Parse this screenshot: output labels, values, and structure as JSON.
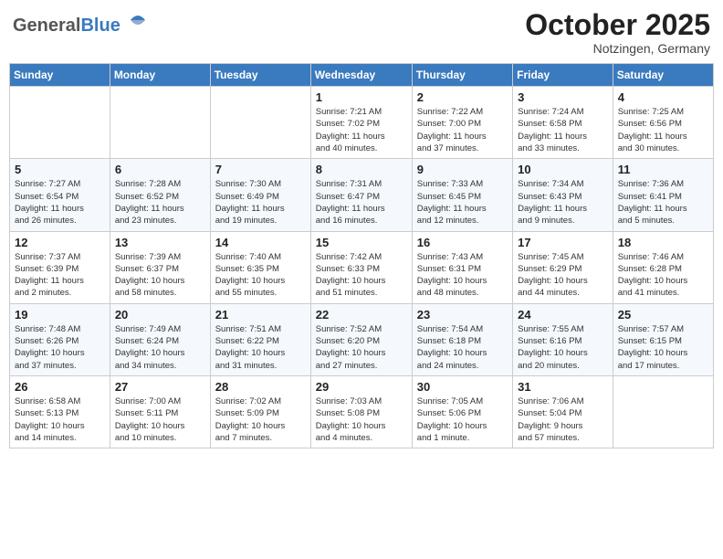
{
  "header": {
    "logo_general": "General",
    "logo_blue": "Blue",
    "month": "October 2025",
    "location": "Notzingen, Germany"
  },
  "weekdays": [
    "Sunday",
    "Monday",
    "Tuesday",
    "Wednesday",
    "Thursday",
    "Friday",
    "Saturday"
  ],
  "weeks": [
    [
      {
        "day": "",
        "info": ""
      },
      {
        "day": "",
        "info": ""
      },
      {
        "day": "",
        "info": ""
      },
      {
        "day": "1",
        "info": "Sunrise: 7:21 AM\nSunset: 7:02 PM\nDaylight: 11 hours\nand 40 minutes."
      },
      {
        "day": "2",
        "info": "Sunrise: 7:22 AM\nSunset: 7:00 PM\nDaylight: 11 hours\nand 37 minutes."
      },
      {
        "day": "3",
        "info": "Sunrise: 7:24 AM\nSunset: 6:58 PM\nDaylight: 11 hours\nand 33 minutes."
      },
      {
        "day": "4",
        "info": "Sunrise: 7:25 AM\nSunset: 6:56 PM\nDaylight: 11 hours\nand 30 minutes."
      }
    ],
    [
      {
        "day": "5",
        "info": "Sunrise: 7:27 AM\nSunset: 6:54 PM\nDaylight: 11 hours\nand 26 minutes."
      },
      {
        "day": "6",
        "info": "Sunrise: 7:28 AM\nSunset: 6:52 PM\nDaylight: 11 hours\nand 23 minutes."
      },
      {
        "day": "7",
        "info": "Sunrise: 7:30 AM\nSunset: 6:49 PM\nDaylight: 11 hours\nand 19 minutes."
      },
      {
        "day": "8",
        "info": "Sunrise: 7:31 AM\nSunset: 6:47 PM\nDaylight: 11 hours\nand 16 minutes."
      },
      {
        "day": "9",
        "info": "Sunrise: 7:33 AM\nSunset: 6:45 PM\nDaylight: 11 hours\nand 12 minutes."
      },
      {
        "day": "10",
        "info": "Sunrise: 7:34 AM\nSunset: 6:43 PM\nDaylight: 11 hours\nand 9 minutes."
      },
      {
        "day": "11",
        "info": "Sunrise: 7:36 AM\nSunset: 6:41 PM\nDaylight: 11 hours\nand 5 minutes."
      }
    ],
    [
      {
        "day": "12",
        "info": "Sunrise: 7:37 AM\nSunset: 6:39 PM\nDaylight: 11 hours\nand 2 minutes."
      },
      {
        "day": "13",
        "info": "Sunrise: 7:39 AM\nSunset: 6:37 PM\nDaylight: 10 hours\nand 58 minutes."
      },
      {
        "day": "14",
        "info": "Sunrise: 7:40 AM\nSunset: 6:35 PM\nDaylight: 10 hours\nand 55 minutes."
      },
      {
        "day": "15",
        "info": "Sunrise: 7:42 AM\nSunset: 6:33 PM\nDaylight: 10 hours\nand 51 minutes."
      },
      {
        "day": "16",
        "info": "Sunrise: 7:43 AM\nSunset: 6:31 PM\nDaylight: 10 hours\nand 48 minutes."
      },
      {
        "day": "17",
        "info": "Sunrise: 7:45 AM\nSunset: 6:29 PM\nDaylight: 10 hours\nand 44 minutes."
      },
      {
        "day": "18",
        "info": "Sunrise: 7:46 AM\nSunset: 6:28 PM\nDaylight: 10 hours\nand 41 minutes."
      }
    ],
    [
      {
        "day": "19",
        "info": "Sunrise: 7:48 AM\nSunset: 6:26 PM\nDaylight: 10 hours\nand 37 minutes."
      },
      {
        "day": "20",
        "info": "Sunrise: 7:49 AM\nSunset: 6:24 PM\nDaylight: 10 hours\nand 34 minutes."
      },
      {
        "day": "21",
        "info": "Sunrise: 7:51 AM\nSunset: 6:22 PM\nDaylight: 10 hours\nand 31 minutes."
      },
      {
        "day": "22",
        "info": "Sunrise: 7:52 AM\nSunset: 6:20 PM\nDaylight: 10 hours\nand 27 minutes."
      },
      {
        "day": "23",
        "info": "Sunrise: 7:54 AM\nSunset: 6:18 PM\nDaylight: 10 hours\nand 24 minutes."
      },
      {
        "day": "24",
        "info": "Sunrise: 7:55 AM\nSunset: 6:16 PM\nDaylight: 10 hours\nand 20 minutes."
      },
      {
        "day": "25",
        "info": "Sunrise: 7:57 AM\nSunset: 6:15 PM\nDaylight: 10 hours\nand 17 minutes."
      }
    ],
    [
      {
        "day": "26",
        "info": "Sunrise: 6:58 AM\nSunset: 5:13 PM\nDaylight: 10 hours\nand 14 minutes."
      },
      {
        "day": "27",
        "info": "Sunrise: 7:00 AM\nSunset: 5:11 PM\nDaylight: 10 hours\nand 10 minutes."
      },
      {
        "day": "28",
        "info": "Sunrise: 7:02 AM\nSunset: 5:09 PM\nDaylight: 10 hours\nand 7 minutes."
      },
      {
        "day": "29",
        "info": "Sunrise: 7:03 AM\nSunset: 5:08 PM\nDaylight: 10 hours\nand 4 minutes."
      },
      {
        "day": "30",
        "info": "Sunrise: 7:05 AM\nSunset: 5:06 PM\nDaylight: 10 hours\nand 1 minute."
      },
      {
        "day": "31",
        "info": "Sunrise: 7:06 AM\nSunset: 5:04 PM\nDaylight: 9 hours\nand 57 minutes."
      },
      {
        "day": "",
        "info": ""
      }
    ]
  ]
}
